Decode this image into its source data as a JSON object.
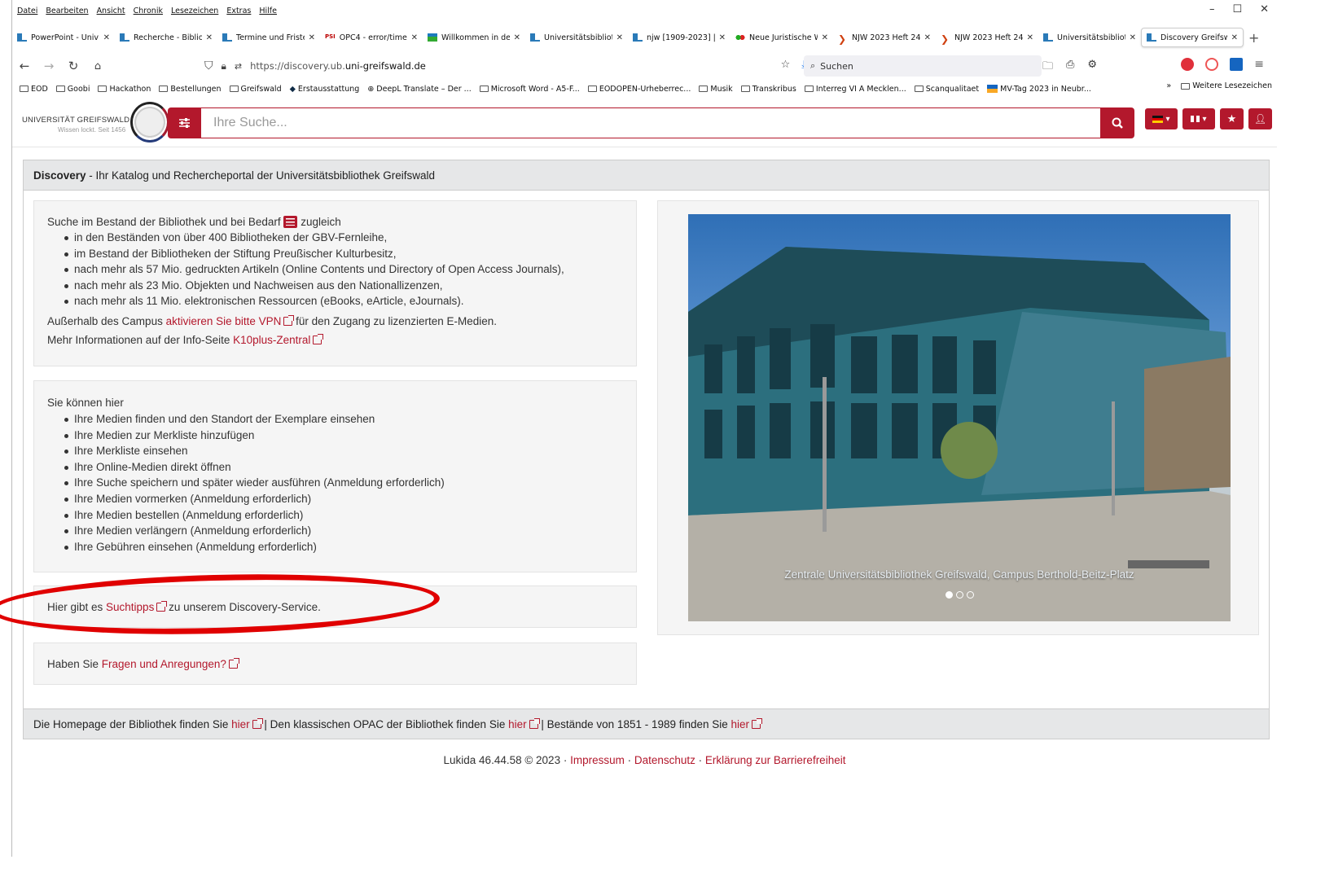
{
  "menubar": {
    "items": [
      "Datei",
      "Bearbeiten",
      "Ansicht",
      "Chronik",
      "Lesezeichen",
      "Extras",
      "Hilfe"
    ],
    "min": "–",
    "max": "☐",
    "close": "✕"
  },
  "tabs": [
    {
      "label": "PowerPoint - Univ",
      "fav": "ub"
    },
    {
      "label": "Recherche - Biblio",
      "fav": "ub"
    },
    {
      "label": "Termine und Friste",
      "fav": "ub"
    },
    {
      "label": "OPC4 - error/time",
      "fav": "psi"
    },
    {
      "label": "Willkommen in de",
      "fav": "green"
    },
    {
      "label": "Universitätsbibliot",
      "fav": "ub"
    },
    {
      "label": "njw [1909-2023] | i",
      "fav": "ub"
    },
    {
      "label": "Neue Juristische W",
      "fav": "nj"
    },
    {
      "label": "NJW 2023 Heft 24",
      "fav": "njw"
    },
    {
      "label": "NJW 2023 Heft 24",
      "fav": "njw"
    },
    {
      "label": "Universitätsbibliot",
      "fav": "ub"
    },
    {
      "label": "Discovery Greifsw",
      "fav": "ub",
      "active": true
    }
  ],
  "tab_close": "✕",
  "new_tab": "+",
  "nav": {
    "url_prefix": "https://discovery.ub.",
    "url_domain": "uni-greifswald.de",
    "search_placeholder": "Suchen"
  },
  "bookmarks": [
    "EOD",
    "Goobi",
    "Hackathon",
    "Bestellungen",
    "Greifswald",
    "Erstausstattung",
    "DeepL Translate – Der ...",
    "Microsoft Word - A5-F...",
    "EODOPEN-Urheberrec...",
    "Musik",
    "Transkribus",
    "Interreg VI A Mecklen...",
    "Scanqualitaet",
    "MV-Tag 2023 in Neubr..."
  ],
  "bookmarks_more": "Weitere Lesezeichen",
  "logo": {
    "name": "UNIVERSITÄT GREIFSWALD",
    "slogan": "Wissen lockt. Seit 1456"
  },
  "search": {
    "placeholder": "Ihre Suche..."
  },
  "panel": {
    "title_bold": "Discovery",
    "title_rest": " - Ihr Katalog und Rechercheportal der Universitätsbibliothek Greifswald"
  },
  "box1": {
    "intro_a": "Suche im Bestand der Bibliothek und bei Bedarf ",
    "intro_b": " zugleich",
    "items": [
      "in den Beständen von über 400 Bibliotheken der GBV-Fernleihe,",
      "im Bestand der Bibliotheken der Stiftung Preußischer Kulturbesitz,",
      "nach mehr als 57 Mio. gedruckten Artikeln (Online Contents und Directory of Open Access Journals),",
      "nach mehr als 23 Mio. Objekten und Nachweisen aus den Nationallizenzen,",
      "nach mehr als 11 Mio. elektronischen Ressourcen (eBooks, eArticle, eJournals)."
    ],
    "vpn_a": "Außerhalb des Campus ",
    "vpn_link": "aktivieren Sie bitte VPN",
    "vpn_b": " für den Zugang zu lizenzierten E-Medien.",
    "info_a": "Mehr Informationen auf der Info-Seite ",
    "info_link": "K10plus-Zentral"
  },
  "box2": {
    "intro": "Sie können hier",
    "items": [
      "Ihre Medien finden und den Standort der Exemplare einsehen",
      "Ihre Medien zur Merkliste hinzufügen",
      "Ihre Merkliste einsehen",
      "Ihre Online-Medien direkt öffnen",
      "Ihre Suche speichern und später wieder ausführen (Anmeldung erforderlich)",
      "Ihre Medien vormerken (Anmeldung erforderlich)",
      "Ihre Medien bestellen (Anmeldung erforderlich)",
      "Ihre Medien verlängern (Anmeldung erforderlich)",
      "Ihre Gebühren einsehen (Anmeldung erforderlich)"
    ]
  },
  "box3": {
    "a": "Hier gibt es ",
    "link": "Suchtipps",
    "b": " zu unserem Discovery-Service."
  },
  "box4": {
    "a": "Haben Sie ",
    "link": "Fragen und Anregungen?"
  },
  "carousel": {
    "caption": "Zentrale Universitätsbibliothek Greifswald, Campus Berthold-Beitz-Platz"
  },
  "footer": {
    "a": "Die Homepage der Bibliothek finden Sie ",
    "l1": "hier",
    "b": " | Den klassischen OPAC der Bibliothek finden Sie ",
    "l2": "hier",
    "c": " | Bestände von 1851 - 1989 finden Sie ",
    "l3": "hier"
  },
  "pagefoot": {
    "version": "Lukida 46.44.58 © 2023 · ",
    "impressum": "Impressum",
    "sep": " · ",
    "datenschutz": "Datenschutz",
    "barriere": "Erklärung zur Barrierefreiheit"
  },
  "colors": {
    "accent": "#b3182c",
    "annotation": "#e00000"
  }
}
